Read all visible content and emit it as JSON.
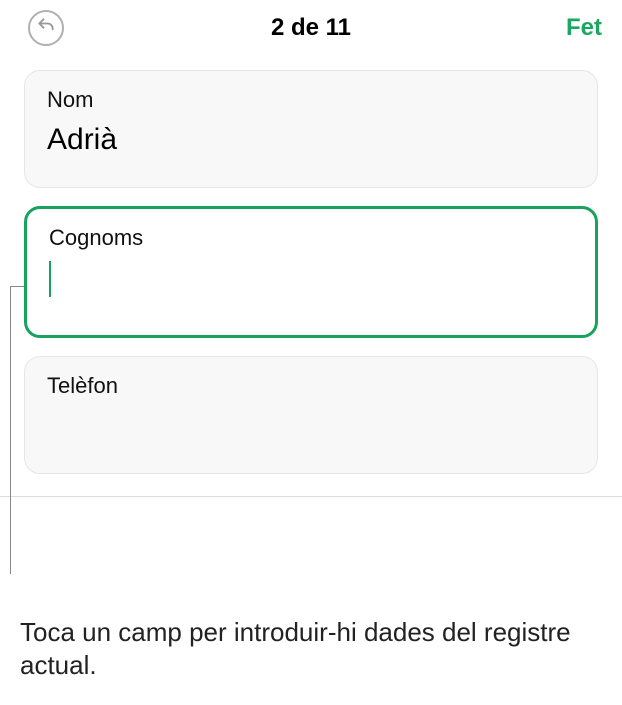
{
  "header": {
    "back_icon": "undo-icon",
    "title": "2 de 11",
    "done_label": "Fet"
  },
  "fields": [
    {
      "label": "Nom",
      "value": "Adrià",
      "active": false
    },
    {
      "label": "Cognoms",
      "value": "",
      "active": true
    },
    {
      "label": "Telèfon",
      "value": "",
      "active": false
    }
  ],
  "annotation": "Toca un camp per introduir-hi dades del registre actual."
}
